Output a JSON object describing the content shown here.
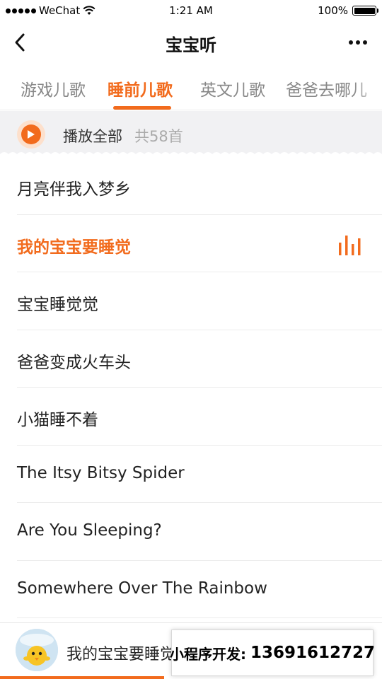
{
  "status_bar": {
    "carrier": "WeChat",
    "time": "1:21 AM",
    "battery": "100%"
  },
  "nav": {
    "title": "宝宝听"
  },
  "tabs": [
    {
      "label": "游戏儿歌",
      "active": false
    },
    {
      "label": "睡前儿歌",
      "active": true
    },
    {
      "label": "英文儿歌",
      "active": false
    },
    {
      "label": "爸爸去哪儿",
      "active": false
    }
  ],
  "play_all": {
    "label": "播放全部",
    "count": "共58首"
  },
  "songs": [
    {
      "title": "月亮伴我入梦乡",
      "playing": false
    },
    {
      "title": "我的宝宝要睡觉",
      "playing": true
    },
    {
      "title": "宝宝睡觉觉",
      "playing": false
    },
    {
      "title": "爸爸变成火车头",
      "playing": false
    },
    {
      "title": "小猫睡不着",
      "playing": false
    },
    {
      "title": "The Itsy Bitsy Spider",
      "playing": false
    },
    {
      "title": "Are You Sleeping?",
      "playing": false
    },
    {
      "title": "Somewhere Over The Rainbow",
      "playing": false
    }
  ],
  "player": {
    "current_title": "我的宝宝要睡觉",
    "progress": 0.43
  },
  "promo": {
    "label": "小程序开发:",
    "phone": "13691612727"
  },
  "colors": {
    "accent": "#f26b1d",
    "muted_text": "#888888",
    "background_band": "#f1f1f3"
  }
}
